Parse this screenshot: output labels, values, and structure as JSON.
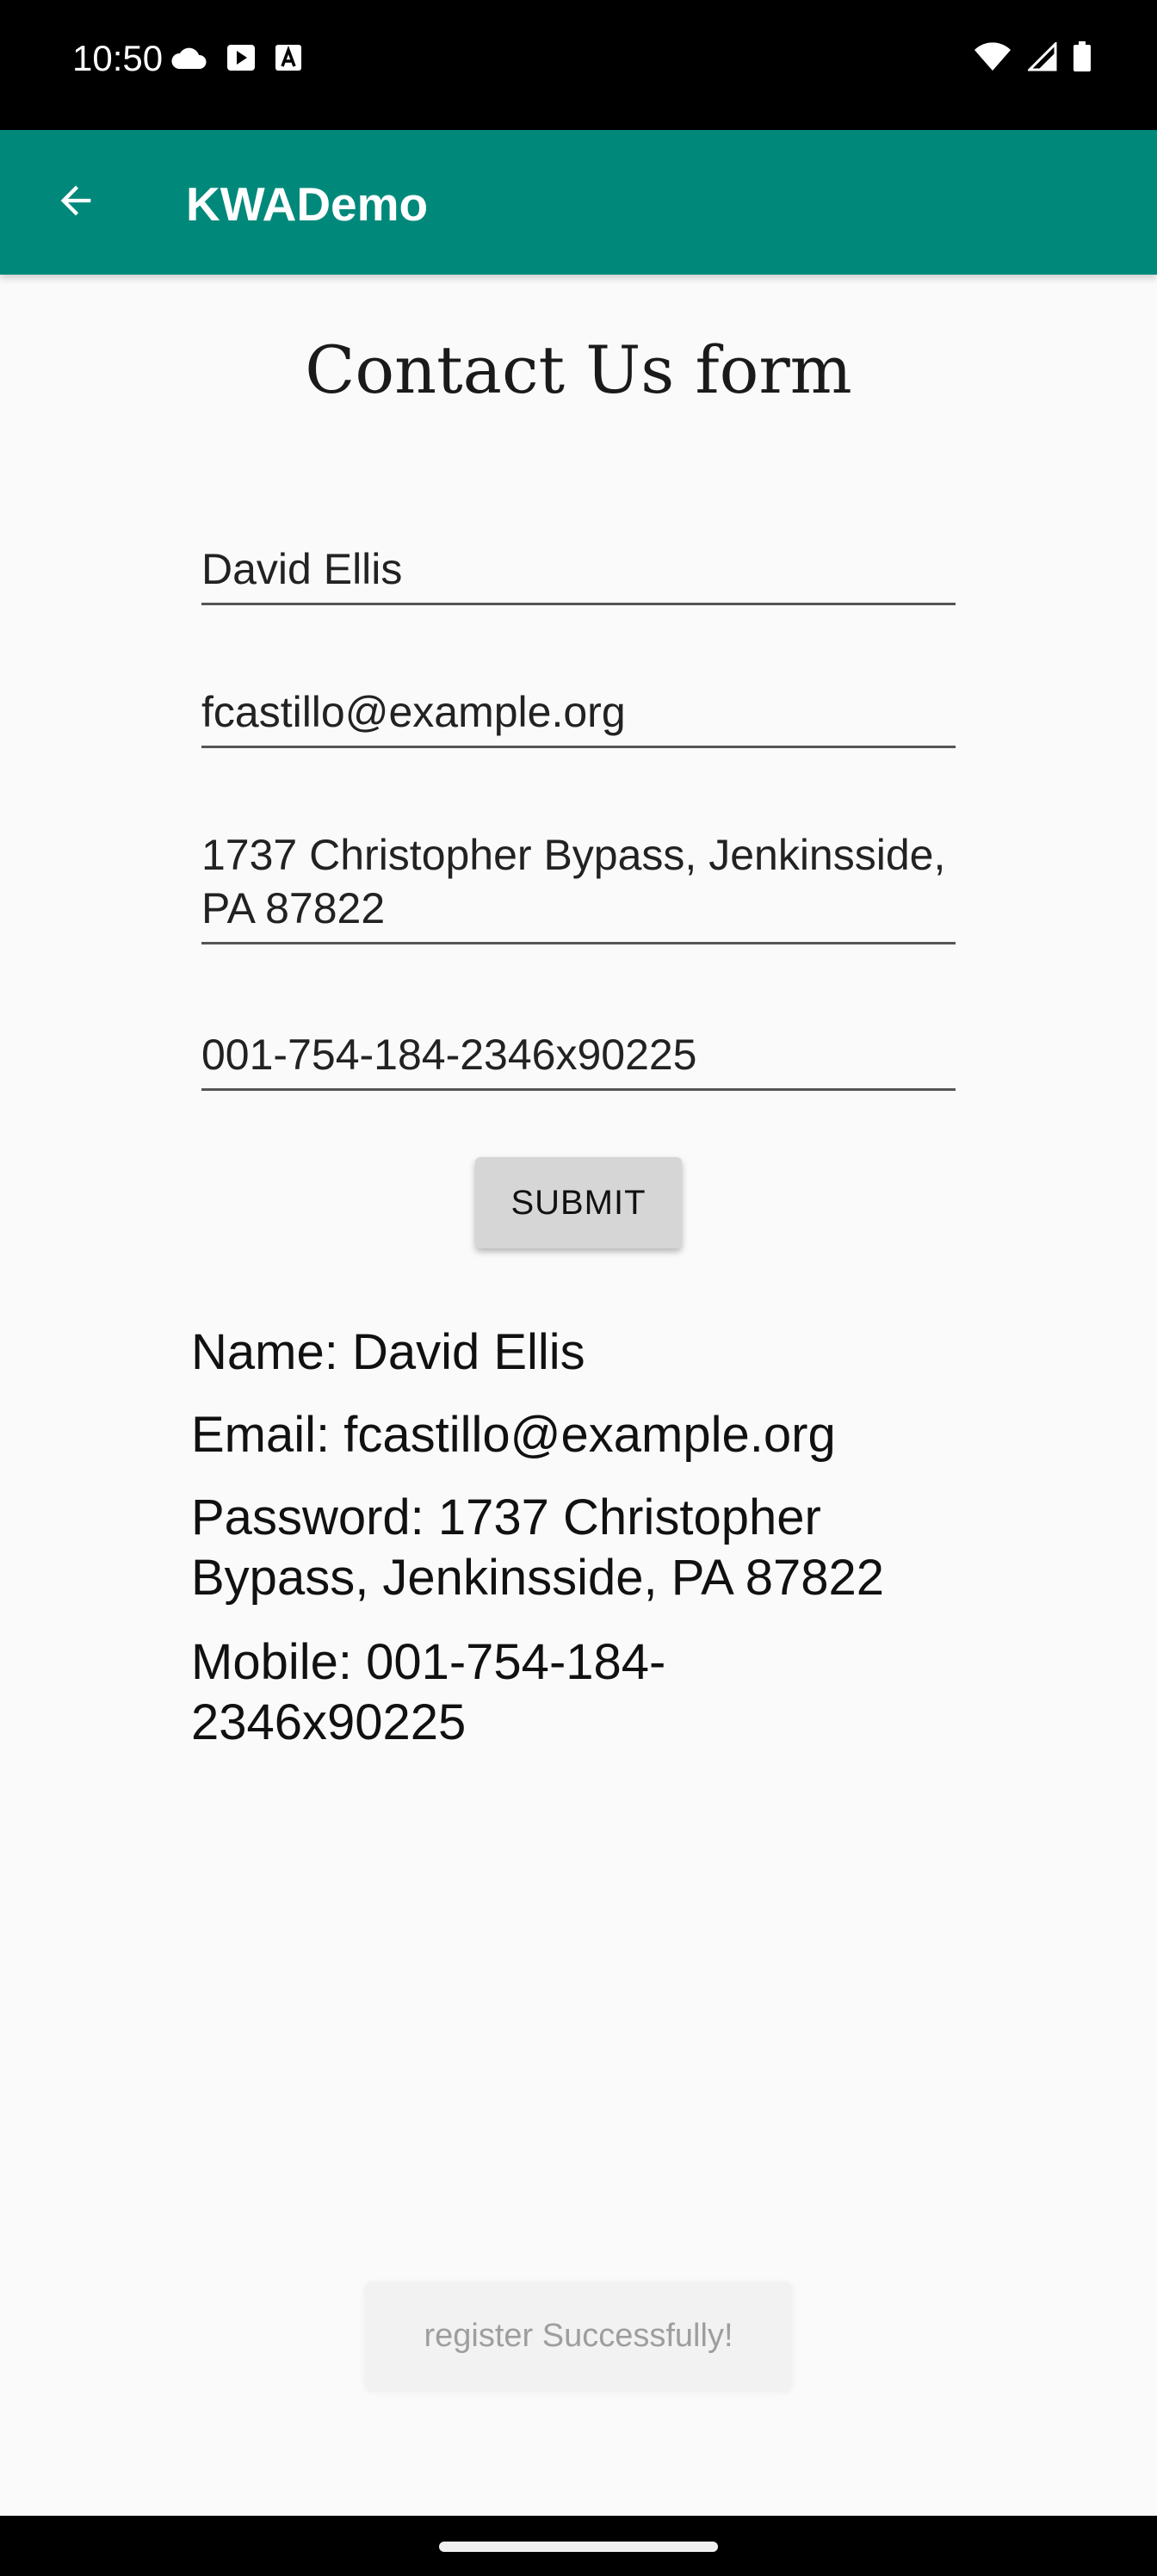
{
  "status_bar": {
    "time": "10:50",
    "left_icons": [
      "cloud-icon",
      "play-icon",
      "text-a-icon"
    ],
    "right_icons": [
      "wifi-icon",
      "signal-icon",
      "battery-icon"
    ]
  },
  "app_bar": {
    "title": "KWADemo",
    "back_icon": "arrow-left-icon",
    "color": "#00897b"
  },
  "form": {
    "title": "Contact Us form",
    "fields": {
      "name": "David Ellis",
      "email": "fcastillo@example.org",
      "address": "1737 Christopher Bypass, Jenkinsside, PA 87822",
      "mobile": "001-754-184-2346x90225"
    },
    "submit_label": "SUBMIT"
  },
  "result": {
    "name": "Name: David Ellis",
    "email": "Email: fcastillo@example.org",
    "password": "Password: 1737 Christopher Bypass, Jenkinsside, PA 87822",
    "mobile": "Mobile: 001-754-184-2346x90225"
  },
  "toast": {
    "message": "register Successfully!"
  }
}
